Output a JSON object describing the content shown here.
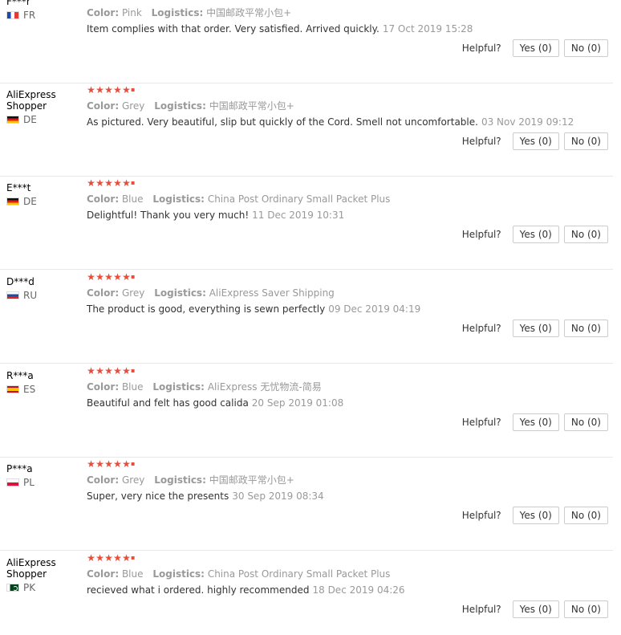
{
  "helpful_label": "Helpful?",
  "star_color": "#e84d3a",
  "reviews": [
    {
      "name": "F***r",
      "country": "FR",
      "flag": "flag-fr",
      "color_label": "Color:",
      "color": "Pink",
      "logistics_label": "Logistics:",
      "logistics": "中国邮政平常小包+",
      "comment": "Item complies with that order. Very satisfied. Arrived quickly.",
      "date": "17 Oct 2019 15:28",
      "yes": "Yes (0)",
      "no": "No (0)"
    },
    {
      "name": "AliExpress Shopper",
      "country": "DE",
      "flag": "flag-de",
      "color_label": "Color:",
      "color": "Grey",
      "logistics_label": "Logistics:",
      "logistics": "中国邮政平常小包+",
      "comment": "As pictured. Very beautiful, slip but quickly of the Cord. Smell not uncomfortable.",
      "date": "03 Nov 2019 09:12",
      "yes": "Yes (0)",
      "no": "No (0)"
    },
    {
      "name": "E***t",
      "country": "DE",
      "flag": "flag-de",
      "color_label": "Color:",
      "color": "Blue",
      "logistics_label": "Logistics:",
      "logistics": "China Post Ordinary Small Packet Plus",
      "comment": "Delightful! Thank you very much!",
      "date": "11 Dec 2019 10:31",
      "yes": "Yes (0)",
      "no": "No (0)"
    },
    {
      "name": "D***d",
      "country": "RU",
      "flag": "flag-ru",
      "color_label": "Color:",
      "color": "Grey",
      "logistics_label": "Logistics:",
      "logistics": "AliExpress Saver Shipping",
      "comment": "The product is good, everything is sewn perfectly",
      "date": "09 Dec 2019 04:19",
      "yes": "Yes (0)",
      "no": "No (0)"
    },
    {
      "name": "R***a",
      "country": "ES",
      "flag": "flag-es",
      "color_label": "Color:",
      "color": "Blue",
      "logistics_label": "Logistics:",
      "logistics": "AliExpress 无忧物流-简易",
      "comment": "Beautiful and felt has good calida",
      "date": "20 Sep 2019 01:08",
      "yes": "Yes (0)",
      "no": "No (0)"
    },
    {
      "name": "P***a",
      "country": "PL",
      "flag": "flag-pl",
      "color_label": "Color:",
      "color": "Grey",
      "logistics_label": "Logistics:",
      "logistics": "中国邮政平常小包+",
      "comment": "Super, very nice the presents",
      "date": "30 Sep 2019 08:34",
      "yes": "Yes (0)",
      "no": "No (0)"
    },
    {
      "name": "AliExpress Shopper",
      "country": "PK",
      "flag": "flag-pk",
      "color_label": "Color:",
      "color": "Blue",
      "logistics_label": "Logistics:",
      "logistics": "China Post Ordinary Small Packet Plus",
      "comment": "recieved what i ordered. highly recommended",
      "date": "18 Dec 2019 04:26",
      "yes": "Yes (0)",
      "no": "No (0)"
    }
  ]
}
